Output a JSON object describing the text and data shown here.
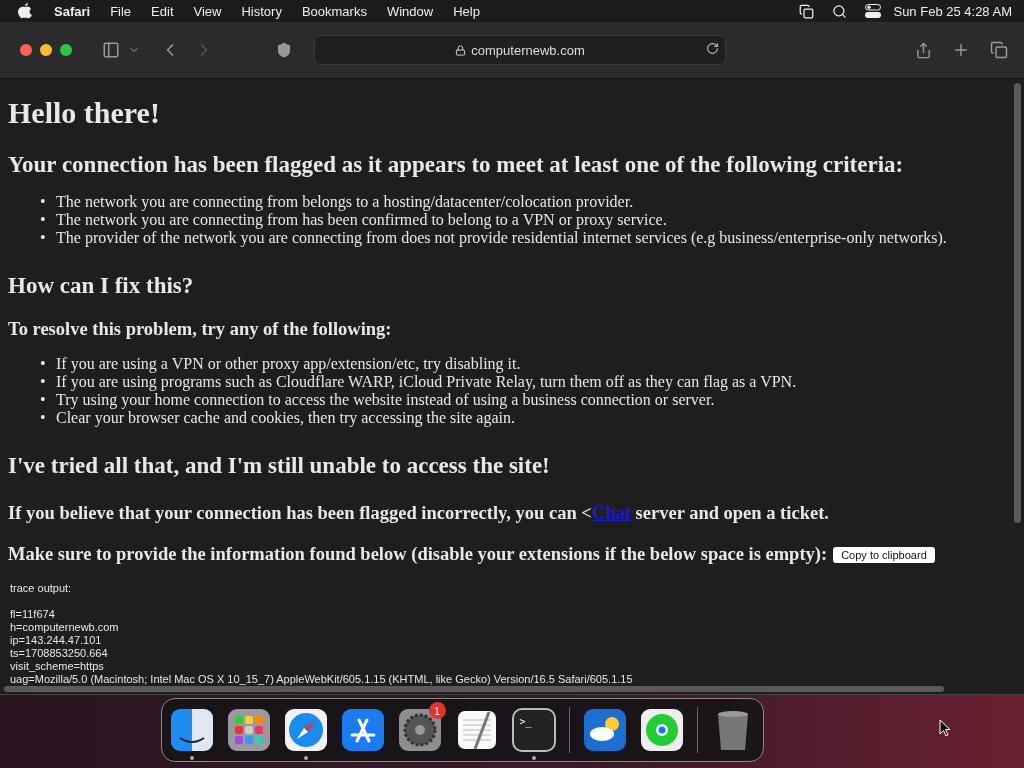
{
  "menu_bar": {
    "app_name": "Safari",
    "items": [
      "File",
      "Edit",
      "View",
      "History",
      "Bookmarks",
      "Window",
      "Help"
    ],
    "clock": "Sun Feb 25  4:28 AM"
  },
  "toolbar": {
    "address": "computernewb.com"
  },
  "page": {
    "title": "Hello there!",
    "sections": [
      {
        "kind": "h2",
        "text": "Your connection has been flagged as it appears to meet at least one of the following criteria:"
      },
      {
        "kind": "list",
        "marker": "•",
        "items": [
          "The network you are connecting from belongs to a hosting/datacenter/colocation provider.",
          "The network you are connecting from has been confirmed to belong to a VPN or proxy service.",
          "The provider of the network you are connecting from does not provide residential internet services (e.g business/enterprise-only networks)."
        ]
      },
      {
        "kind": "h2",
        "text": "How can I fix this?"
      },
      {
        "kind": "h3",
        "text": "To resolve this problem, try any of the following:"
      },
      {
        "kind": "list",
        "marker": "•",
        "items": [
          "If you are using a VPN or other proxy app/extension/etc, try disabling it.",
          "If you are using programs such as Cloudflare WARP, iCloud Private Relay, turn them off as they can flag as a VPN.",
          "Try using your home connection to access the website instead of using a business connection or server.",
          "Clear your browser cache and cookies, then try accessing the site again."
        ]
      },
      {
        "kind": "h2",
        "text": "I've tried all that, and I'm still unable to access the site!"
      },
      {
        "kind": "link_paragraph",
        "before": "If you believe that your connection has been flagged incorrectly, you can <",
        "link": "Chat",
        "after": " server and open a ticket."
      },
      {
        "kind": "button_paragraph",
        "text": "Make sure to provide the information found below (disable your extensions if the below space is empty):",
        "button": "Copy to clipboard"
      }
    ],
    "trace_title": "trace output:",
    "trace": [
      "fl=11f674",
      "h=computernewb.com",
      "ip=143.244.47.101",
      "ts=1708853250.664",
      "visit_scheme=https",
      "uag=Mozilla/5.0 (Macintosh; Intel Mac OS X 10_15_7) AppleWebKit/605.1.15 (KHTML, like Gecko) Version/16.5 Safari/605.1.15"
    ]
  },
  "dock": {
    "apps": [
      {
        "kind": "finder",
        "running": true
      },
      {
        "kind": "launchpad",
        "running": false
      },
      {
        "kind": "safari",
        "running": true
      },
      {
        "kind": "appstore",
        "running": false
      },
      {
        "kind": "settings",
        "running": false,
        "badge": "1"
      },
      {
        "kind": "textedit",
        "running": false
      },
      {
        "kind": "terminal",
        "running": true,
        "glyph": ">_"
      },
      {
        "kind": "separator"
      },
      {
        "kind": "weather",
        "running": false
      },
      {
        "kind": "findmy",
        "running": false
      },
      {
        "kind": "separator"
      },
      {
        "kind": "trash",
        "running": false
      }
    ]
  }
}
